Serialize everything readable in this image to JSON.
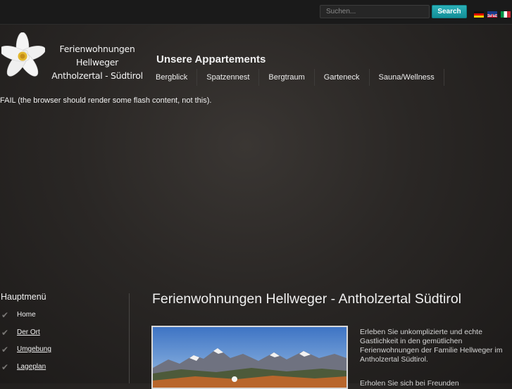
{
  "search": {
    "placeholder": "Suchen...",
    "button_label": "Search"
  },
  "languages": [
    {
      "name": "de-flag-icon"
    },
    {
      "name": "en-flag-icon"
    },
    {
      "name": "it-flag-icon"
    }
  ],
  "logo": {
    "line1": "Ferienwohnungen Hellweger",
    "line2": "Antholzertal - Südtirol"
  },
  "section_title": "Unsere Appartements",
  "nav": [
    "Bergblick",
    "Spatzennest",
    "Bergtraum",
    "Garteneck",
    "Sauna/Wellness"
  ],
  "flash_fail_text": "FAIL (the browser should render some flash content, not this).",
  "sidebar": {
    "title": "Hauptmenü",
    "items": [
      "Home",
      "Der Ort",
      "Umgebung",
      "Lageplan"
    ]
  },
  "article": {
    "title": "Ferienwohnungen Hellweger - Antholzertal Südtirol",
    "paragraph1": "Erleben Sie unkomplizierte und echte Gastlichkeit in den gemütlichen Ferienwohnungen der Familie Hellweger im Antholzertal Südtirol.",
    "paragraph2_visible": "Erholen Sie sich bei Freunden"
  },
  "colors": {
    "accent": "#1aa0a8",
    "background": "#2a2725",
    "topbar": "#1a1a1a"
  }
}
